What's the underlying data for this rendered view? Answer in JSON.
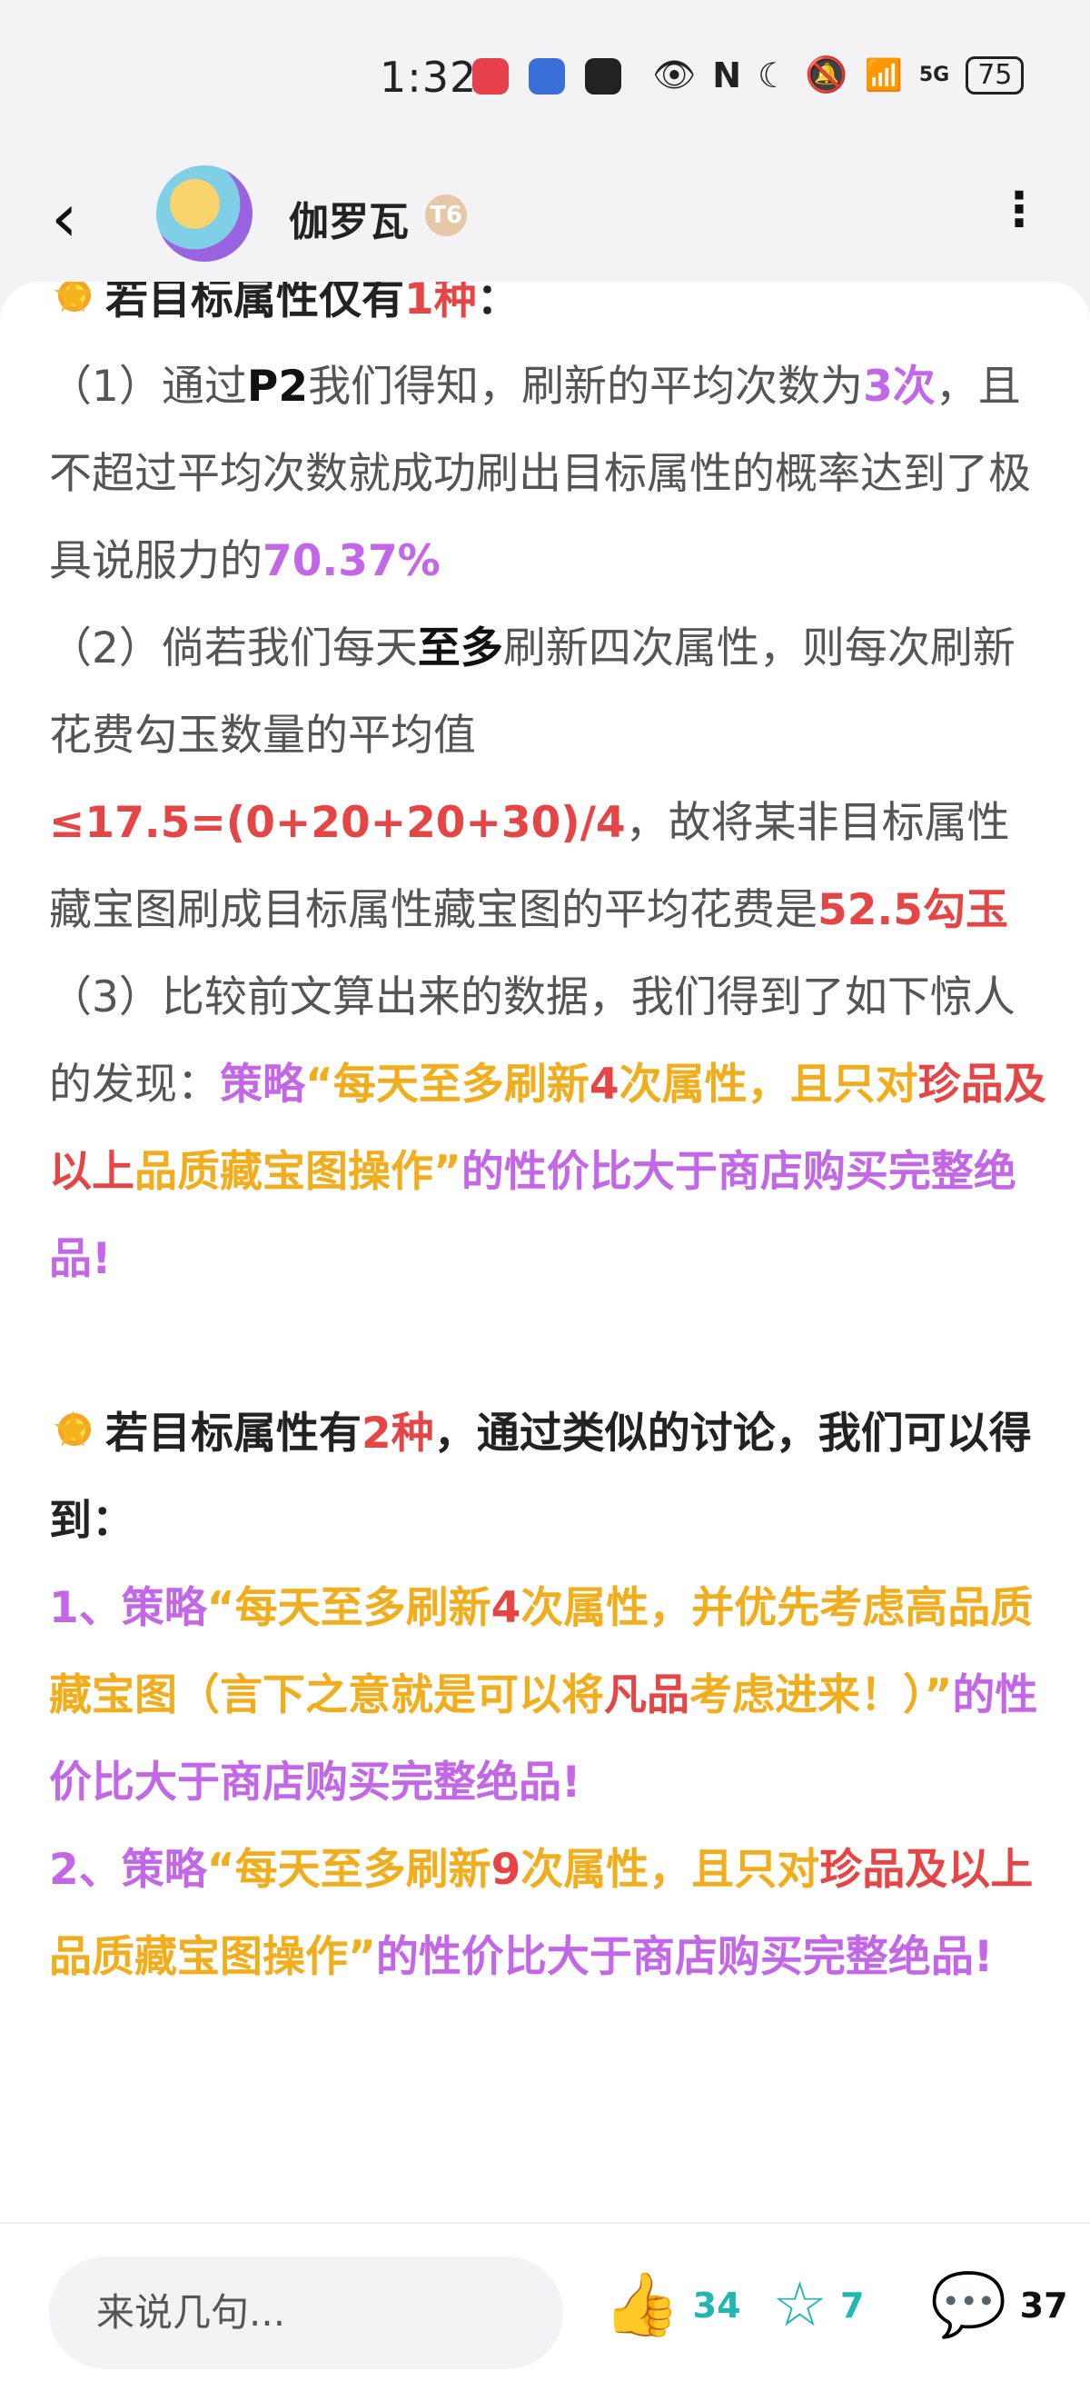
{
  "status_bar": {
    "time": "1:32",
    "battery": "75",
    "network": "5G"
  },
  "header": {
    "username": "伽罗瓦",
    "level_badge": "T6",
    "back_icon": "back-chevron-icon",
    "more_icon": "more-vertical-icon"
  },
  "article": {
    "section1": {
      "title_prefix": "若目标属性仅有",
      "title_num": "1种",
      "title_suffix": "："
    },
    "p1": {
      "a": "（1）通过",
      "b": "P2",
      "c": "我们得知，刷新的平均次数为",
      "d": "3次",
      "e": "，且不超过平均次数就成功刷出目标属性的概率达到了极具说服力的",
      "f": "70.37%"
    },
    "p2": {
      "a": "（2）倘若我们每天",
      "b": "至多",
      "c": "刷新四次属性，则每次刷新花费勾玉数量的平均值",
      "d": "≤17.5=(0+20+20+30)/4",
      "e": "，故将某非目标属性藏宝图刷成目标属性藏宝图的平均花费是",
      "f": "52.5勾玉"
    },
    "p3": {
      "a": "（3）比较前文算出来的数据，我们得到了如下惊人的发现：",
      "b": "策略",
      "c": "“每天至多刷新",
      "d": "4",
      "e": "次属性，且只对",
      "f": "珍品",
      "g": "及以上",
      "h": "品质藏宝图操作”",
      "i": "的性价比大于商店购买完整绝品!"
    },
    "section2": {
      "title_prefix": "若目标属性有",
      "title_num": "2种",
      "title_suffix": "，通过类似的讨论，我们可以得到："
    },
    "item1": {
      "a": "1、策略",
      "b": "“每天至多刷新",
      "c": "4",
      "d": "次属性，并优先考虑高品质藏宝图（言下之意就是可以将",
      "e": "凡品",
      "f": "考虑进来！）”",
      "g": "的性价比大于商店购买完整绝品!"
    },
    "item2": {
      "a": "2、策略",
      "b": "“每天至多刷新",
      "c": "9",
      "d": "次属性，且只对",
      "e": "珍品",
      "f": "及以上",
      "g": "品质藏宝图操作”",
      "h": "的性价比大于商店购买完整绝品!"
    }
  },
  "bottom_bar": {
    "comment_placeholder": "来说几句...",
    "like_count": "34",
    "favorite_count": "7",
    "comment_count": "37"
  }
}
